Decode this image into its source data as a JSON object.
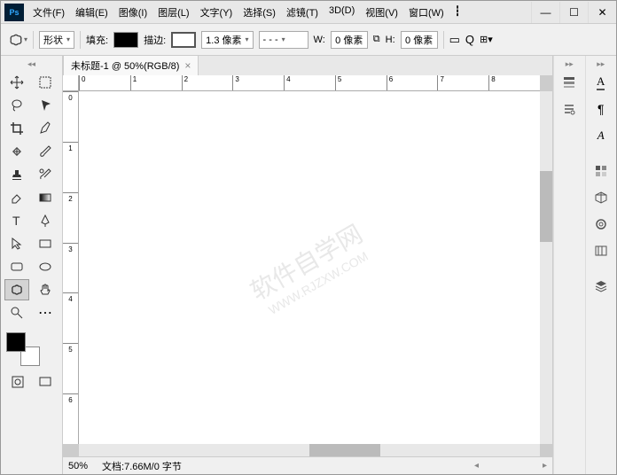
{
  "menu": {
    "items": [
      "文件(F)",
      "编辑(E)",
      "图像(I)",
      "图层(L)",
      "文字(Y)",
      "选择(S)",
      "滤镜(T)",
      "3D(D)",
      "视图(V)",
      "窗口(W)"
    ]
  },
  "options": {
    "shape_mode": "形状",
    "fill_label": "填充:",
    "stroke_label": "描边:",
    "stroke_width": "1.3 像素",
    "stroke_style": "- - -",
    "w_label": "W:",
    "w_value": "0 像素",
    "h_label": "H:",
    "h_value": "0 像素",
    "link_icon": "⧉"
  },
  "document": {
    "tab_title": "未标题-1 @ 50%(RGB/8)"
  },
  "rulers": {
    "h": [
      "0",
      "1",
      "2",
      "3",
      "4",
      "5",
      "6",
      "7",
      "8"
    ],
    "v": [
      "0",
      "1",
      "2",
      "3",
      "4",
      "5",
      "6"
    ]
  },
  "watermark": {
    "main": "软件自学网",
    "sub": "WWW.RJZXW.COM"
  },
  "status": {
    "zoom": "50%",
    "doc_info": "文档:7.66M/0 字节"
  },
  "colors": {
    "fill": "#000000",
    "stroke": "#ffffff"
  }
}
